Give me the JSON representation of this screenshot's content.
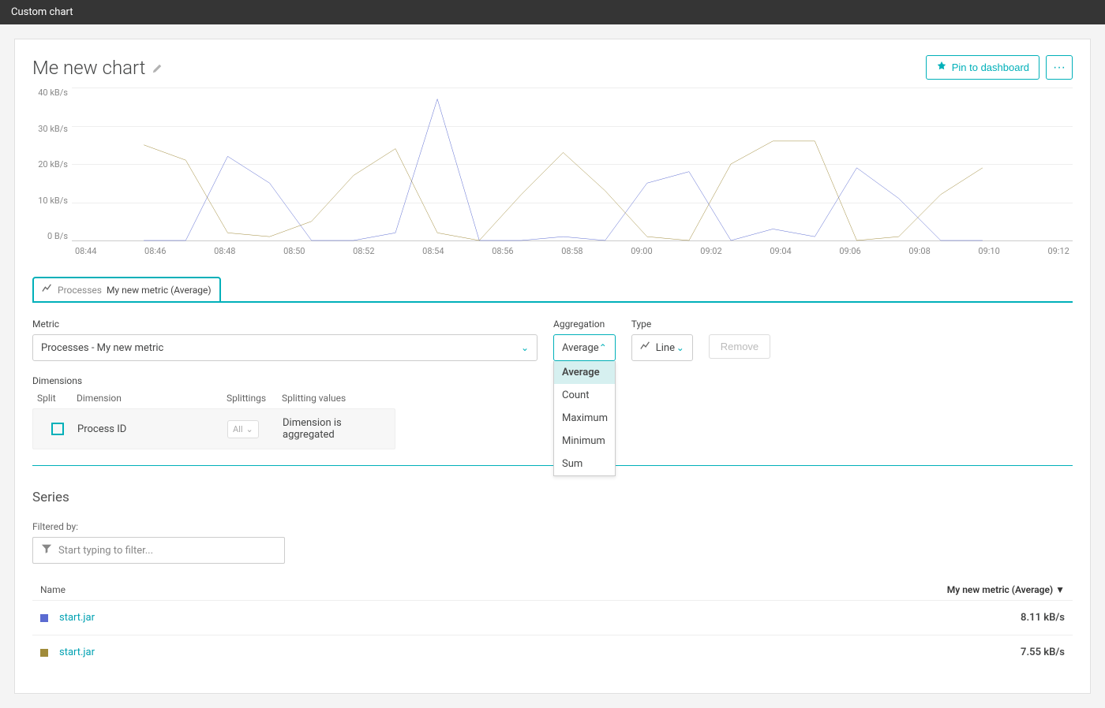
{
  "topbar": {
    "title": "Custom chart"
  },
  "header": {
    "title": "Me new chart",
    "pin_label": "Pin to dashboard",
    "more_label": "···"
  },
  "tab": {
    "group": "Processes",
    "label": "My new metric (Average)"
  },
  "config": {
    "metric_label": "Metric",
    "metric_value": "Processes - My new metric",
    "aggregation_label": "Aggregation",
    "aggregation_value": "Average",
    "aggregation_options": [
      "Average",
      "Count",
      "Maximum",
      "Minimum",
      "Sum"
    ],
    "type_label": "Type",
    "type_value": "Line",
    "remove_label": "Remove"
  },
  "dimensions": {
    "label": "Dimensions",
    "headers": {
      "split": "Split",
      "dimension": "Dimension",
      "splittings": "Splittings",
      "values": "Splitting values"
    },
    "row": {
      "dimension": "Process ID",
      "splittings": "All",
      "values": "Dimension is aggregated"
    }
  },
  "series": {
    "title": "Series",
    "filter_label": "Filtered by:",
    "filter_placeholder": "Start typing to filter...",
    "headers": {
      "name": "Name",
      "metric": "My new metric (Average) ▼"
    },
    "rows": [
      {
        "color": "#5b6bd1",
        "name": "start.jar",
        "value": "8.11 kB/s"
      },
      {
        "color": "#a08b3a",
        "name": "start.jar",
        "value": "7.55 kB/s"
      }
    ]
  },
  "chart_data": {
    "type": "line",
    "ylabel": "kB/s",
    "ylim": [
      0,
      40
    ],
    "y_ticks": [
      "40 kB/s",
      "30 kB/s",
      "20 kB/s",
      "10 kB/s",
      "0 B/s"
    ],
    "x_ticks": [
      "08:44",
      "08:46",
      "08:48",
      "08:50",
      "08:52",
      "08:54",
      "08:56",
      "08:58",
      "09:00",
      "09:02",
      "09:04",
      "09:06",
      "09:08",
      "09:10",
      "09:12"
    ],
    "series": [
      {
        "name": "start.jar",
        "color": "#5b6bd1",
        "values": [
          null,
          0,
          0,
          22,
          15,
          0,
          0,
          2,
          37,
          0,
          0,
          1,
          0,
          15,
          18,
          0,
          3,
          1,
          19,
          11,
          0,
          0
        ]
      },
      {
        "name": "start.jar",
        "color": "#a08b3a",
        "values": [
          null,
          25,
          21,
          2,
          1,
          5,
          17,
          24,
          2,
          0,
          12,
          23,
          13,
          1,
          0,
          20,
          26,
          26,
          0,
          1,
          12,
          19
        ]
      }
    ]
  }
}
